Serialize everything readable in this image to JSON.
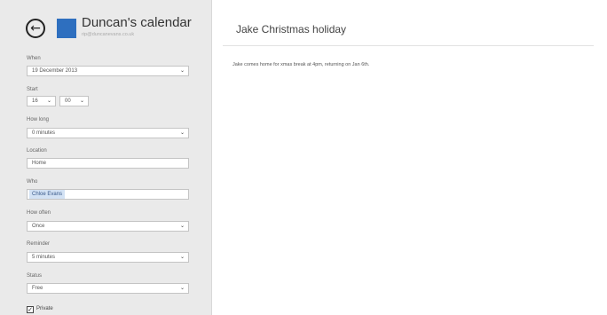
{
  "calendar": {
    "name": "Duncan's calendar",
    "account": "rip@duncanevans.co.uk",
    "color": "#2e6fbf"
  },
  "form": {
    "when_label": "When",
    "when_value": "19 December 2013",
    "start_label": "Start",
    "start_hour": "16",
    "start_minute": "00",
    "how_long_label": "How long",
    "how_long_value": "0 minutes",
    "location_label": "Location",
    "location_value": "Home",
    "who_label": "Who",
    "who_value": "Chloe Evans",
    "how_often_label": "How often",
    "how_often_value": "Once",
    "reminder_label": "Reminder",
    "reminder_value": "5 minutes",
    "status_label": "Status",
    "status_value": "Free",
    "private_label": "Private",
    "private_checked": true
  },
  "event": {
    "title": "Jake Christmas holiday",
    "body": "Jake comes home for xmas break at 4pm, returning on Jan 6th."
  },
  "icons": {
    "back": "back-arrow-icon",
    "dropdown": "chevron-down-icon",
    "check": "checkmark-icon"
  }
}
